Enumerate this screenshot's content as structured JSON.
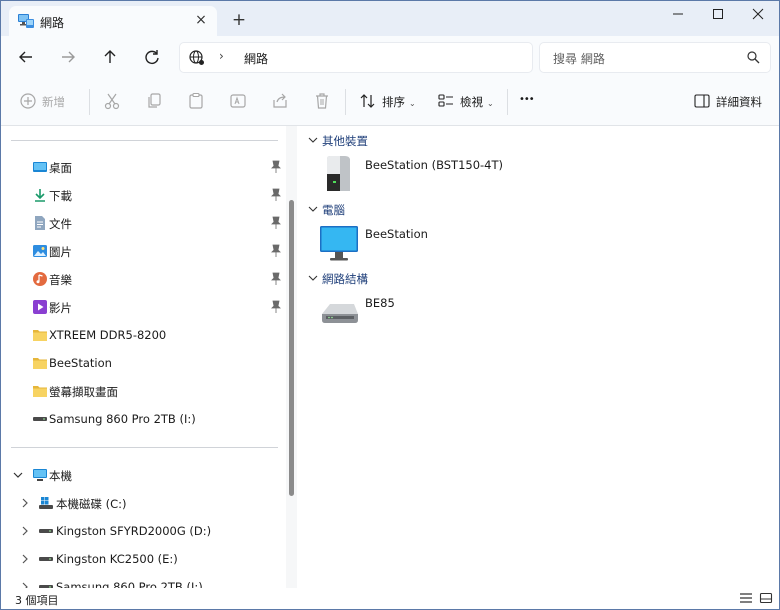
{
  "tab": {
    "title": "網路",
    "close": "×",
    "new_tab": "+"
  },
  "address": {
    "separator": "›",
    "location": "網路"
  },
  "search": {
    "placeholder": "搜尋 網路"
  },
  "toolbar": {
    "new_label": "新增",
    "sort_label": "排序",
    "view_label": "檢視",
    "more_label": "•••",
    "details_label": "詳細資料"
  },
  "sidebar": {
    "quick_access": [
      {
        "label": "桌面",
        "icon": "desktop-icon",
        "pinned": true
      },
      {
        "label": "下載",
        "icon": "download-icon",
        "pinned": true
      },
      {
        "label": "文件",
        "icon": "document-icon",
        "pinned": true
      },
      {
        "label": "圖片",
        "icon": "pictures-icon",
        "pinned": true
      },
      {
        "label": "音樂",
        "icon": "music-icon",
        "pinned": true
      },
      {
        "label": "影片",
        "icon": "videos-icon",
        "pinned": true
      },
      {
        "label": "XTREEM DDR5-8200",
        "icon": "folder-icon",
        "pinned": false
      },
      {
        "label": "BeeStation",
        "icon": "folder-icon",
        "pinned": false
      },
      {
        "label": "螢幕擷取畫面",
        "icon": "folder-icon",
        "pinned": false
      },
      {
        "label": "Samsung 860 Pro 2TB (I:)",
        "icon": "drive-icon",
        "pinned": false
      }
    ],
    "this_pc": {
      "label": "本機",
      "icon": "this-pc-icon"
    },
    "drives": [
      {
        "label": "本機磁碟 (C:)",
        "icon": "windows-drive-icon"
      },
      {
        "label": "Kingston SFYRD2000G (D:)",
        "icon": "drive-icon"
      },
      {
        "label": "Kingston KC2500 (E:)",
        "icon": "drive-icon"
      },
      {
        "label": "Samsung 860 Pro 2TB (I:)",
        "icon": "drive-icon"
      }
    ]
  },
  "groups": [
    {
      "header": "其他裝置",
      "devices": [
        {
          "name": "BeeStation (BST150-4T)",
          "icon": "nas-device-icon"
        }
      ]
    },
    {
      "header": "電腦",
      "devices": [
        {
          "name": "BeeStation",
          "icon": "computer-monitor-icon"
        }
      ]
    },
    {
      "header": "網路結構",
      "devices": [
        {
          "name": "BE85",
          "icon": "router-icon"
        }
      ]
    }
  ],
  "status": {
    "item_count": "3 個項目"
  },
  "colors": {
    "titlebar": "#e8eef7",
    "toolbar": "#f9fbfd",
    "group_header": "#1f3f7a",
    "folder": "#f2c84b"
  }
}
